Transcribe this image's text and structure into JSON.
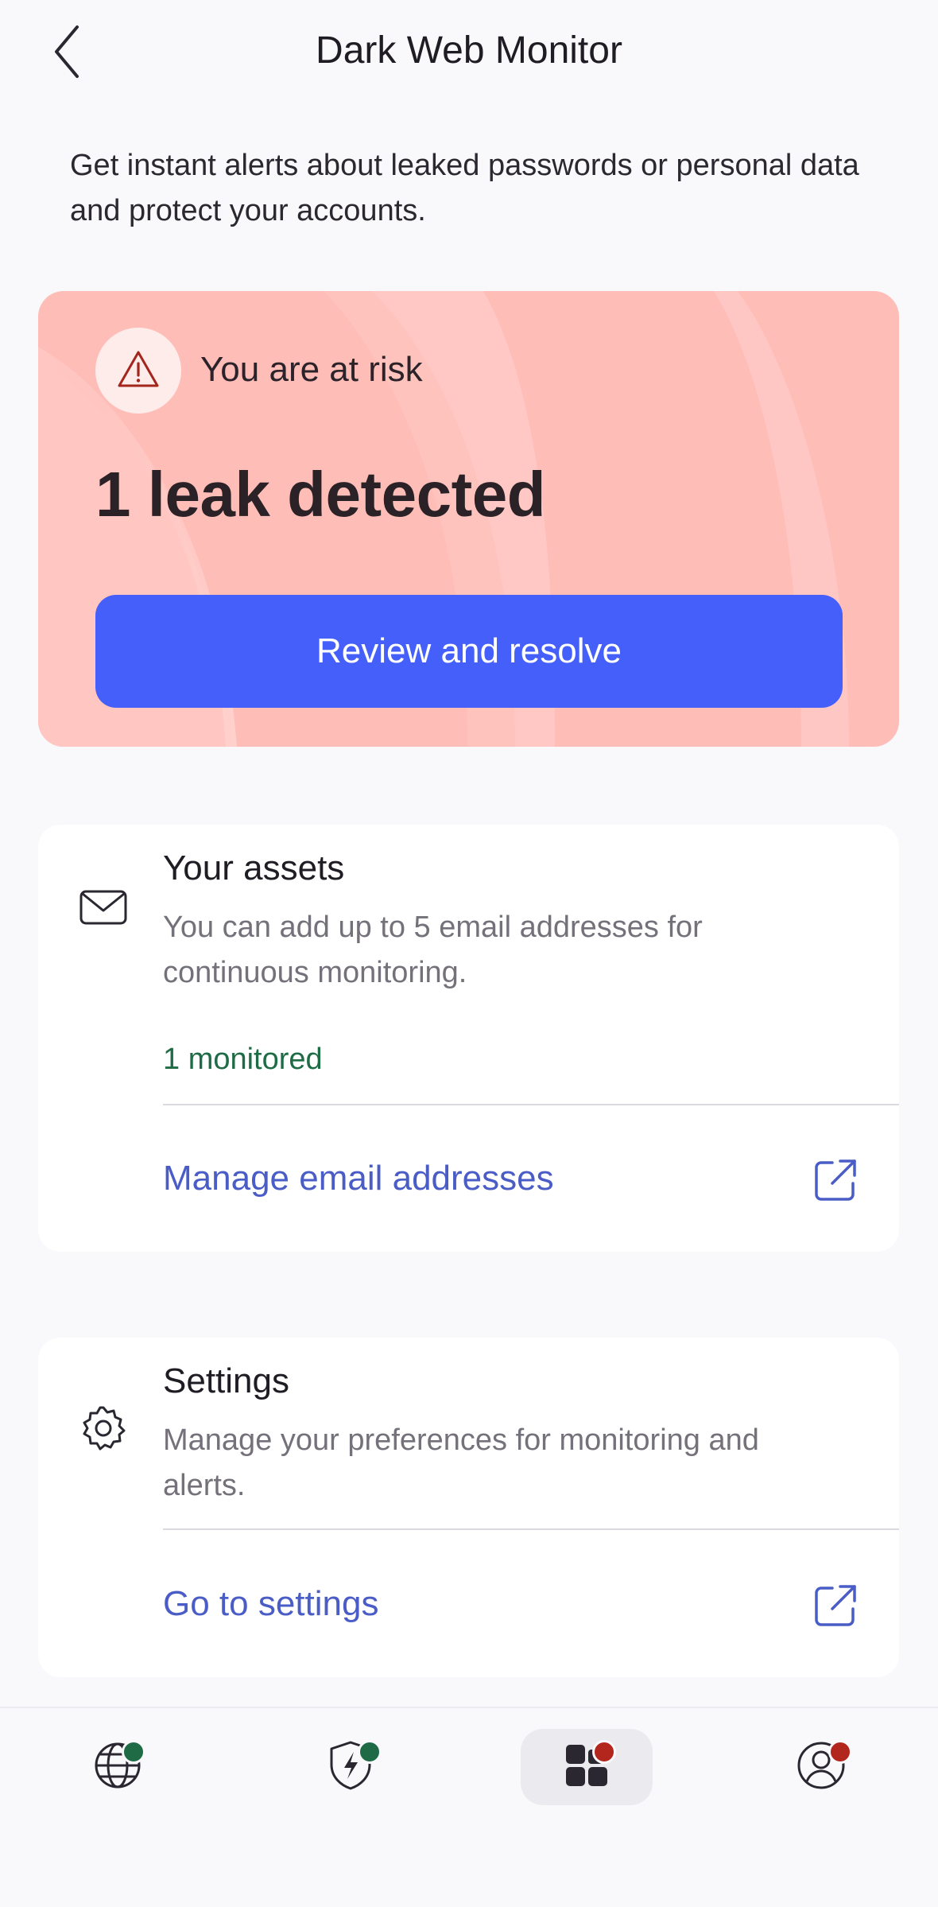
{
  "header": {
    "title": "Dark Web Monitor",
    "back_icon": "chevron-left-icon"
  },
  "intro": "Get instant alerts about leaked passwords or personal data and protect your accounts.",
  "risk_card": {
    "status_icon": "warning-icon",
    "status": "You are at risk",
    "headline": "1 leak detected",
    "button_label": "Review and resolve",
    "background_color": "#ffbdb8",
    "button_color": "#4560fa"
  },
  "assets_card": {
    "icon": "mail-icon",
    "title": "Your assets",
    "description": "You can add up to 5 email addresses for continuous monitoring.",
    "monitored": "1 monitored",
    "link_label": "Manage email addresses",
    "link_icon": "external-link-icon"
  },
  "settings_card": {
    "icon": "gear-icon",
    "title": "Settings",
    "description": "Manage your preferences for monitoring and alerts.",
    "link_label": "Go to settings",
    "link_icon": "external-link-icon"
  },
  "tabbar": {
    "tabs": [
      {
        "icon": "globe-icon",
        "badge_color": "#1e6b46",
        "active": false
      },
      {
        "icon": "shield-bolt-icon",
        "badge_color": "#1e6b46",
        "active": false
      },
      {
        "icon": "dashboard-icon",
        "badge_color": "#b3261e",
        "active": true
      },
      {
        "icon": "account-icon",
        "badge_color": "#b3261e",
        "active": false
      }
    ]
  },
  "colors": {
    "link": "#4a5dc7",
    "monitored": "#1e6b46",
    "alert_dot": "#b3261e",
    "ok_dot": "#1e6b46"
  }
}
